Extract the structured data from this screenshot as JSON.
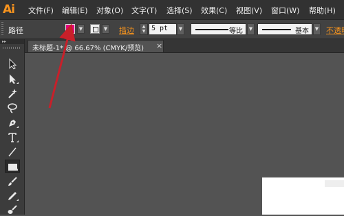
{
  "app": {
    "logo": "Ai"
  },
  "menu": [
    {
      "label": "文件(F)"
    },
    {
      "label": "编辑(E)"
    },
    {
      "label": "对象(O)"
    },
    {
      "label": "文字(T)"
    },
    {
      "label": "选择(S)"
    },
    {
      "label": "效果(C)"
    },
    {
      "label": "视图(V)"
    },
    {
      "label": "窗口(W)"
    },
    {
      "label": "帮助(H)"
    }
  ],
  "control_bar": {
    "selection_label": "路径",
    "fill_color": "#e4007f",
    "stroke_link": "描边",
    "stroke_weight": "5 pt",
    "variable_width_profile": "等比",
    "brush_definition": "基本",
    "opacity_link": "不透明"
  },
  "document": {
    "tab_title": "未标题-1* @ 66.67% (CMYK/预览)",
    "close_glyph": "×"
  },
  "tools": [
    {
      "name": "selection-tool-icon"
    },
    {
      "name": "direct-selection-tool-icon"
    },
    {
      "name": "magic-wand-tool-icon"
    },
    {
      "name": "lasso-tool-icon"
    },
    {
      "name": "pen-tool-icon"
    },
    {
      "name": "type-tool-icon"
    },
    {
      "name": "line-segment-tool-icon"
    },
    {
      "name": "rectangle-tool-icon"
    },
    {
      "name": "paintbrush-tool-icon"
    },
    {
      "name": "pencil-tool-icon"
    },
    {
      "name": "blob-brush-tool-icon"
    }
  ],
  "annotation": {
    "arrow_color": "#c8202a"
  }
}
